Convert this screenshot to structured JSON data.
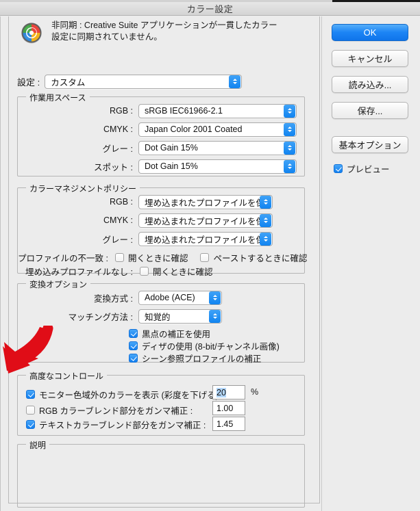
{
  "window": {
    "title": "カラー設定"
  },
  "header": {
    "icon": "color-wheel-icon",
    "message_line1": "非同期 : Creative Suite アプリケーションが一貫したカラー",
    "message_line2": "設定に同期されていません。"
  },
  "settings": {
    "label": "設定 :",
    "value": "カスタム"
  },
  "working_spaces": {
    "legend": "作業用スペース",
    "rows": [
      {
        "label": "RGB :",
        "value": "sRGB IEC61966-2.1"
      },
      {
        "label": "CMYK :",
        "value": "Japan Color 2001 Coated"
      },
      {
        "label": "グレー :",
        "value": "Dot Gain 15%"
      },
      {
        "label": "スポット :",
        "value": "Dot Gain 15%"
      }
    ]
  },
  "policies": {
    "legend": "カラーマネジメントポリシー",
    "rows": [
      {
        "label": "RGB :",
        "value": "埋め込まれたプロファイルを保持"
      },
      {
        "label": "CMYK :",
        "value": "埋め込まれたプロファイルを保持"
      },
      {
        "label": "グレー :",
        "value": "埋め込まれたプロファイルを保持"
      }
    ],
    "mismatch_label": "プロファイルの不一致 :",
    "mismatch_open": {
      "label": "開くときに確認",
      "checked": false
    },
    "mismatch_paste": {
      "label": "ペーストするときに確認",
      "checked": false
    },
    "missing_label": "埋め込みプロファイルなし :",
    "missing_open": {
      "label": "開くときに確認",
      "checked": false
    }
  },
  "conversion": {
    "legend": "変換オプション",
    "engine_label": "変換方式 :",
    "engine_value": "Adobe (ACE)",
    "intent_label": "マッチング方法 :",
    "intent_value": "知覚的",
    "options": [
      {
        "label": "黒点の補正を使用",
        "checked": true
      },
      {
        "label": "ディザの使用 (8-bit/チャンネル画像)",
        "checked": true
      },
      {
        "label": "シーン参照プロファイルの補正",
        "checked": true
      }
    ]
  },
  "advanced": {
    "legend": "高度なコントロール",
    "desaturate": {
      "label": "モニター色域外のカラーを表示 (彩度を下げる) :",
      "checked": true,
      "value": "20",
      "unit": "%"
    },
    "rgb_blend": {
      "label": "RGB カラーブレンド部分をガンマ補正 :",
      "checked": false,
      "value": "1.00"
    },
    "text_blend": {
      "label": "テキストカラーブレンド部分をガンマ補正 :",
      "checked": true,
      "value": "1.45"
    }
  },
  "description": {
    "legend": "説明",
    "text": ""
  },
  "buttons": {
    "ok": "OK",
    "cancel": "キャンセル",
    "load": "読み込み...",
    "save": "保存...",
    "basic_options": "基本オプション",
    "preview": {
      "label": "プレビュー",
      "checked": true
    }
  },
  "colors": {
    "accent": "#1d85f5",
    "annotation_arrow": "#e00d17",
    "window_bg": "#ececec"
  }
}
